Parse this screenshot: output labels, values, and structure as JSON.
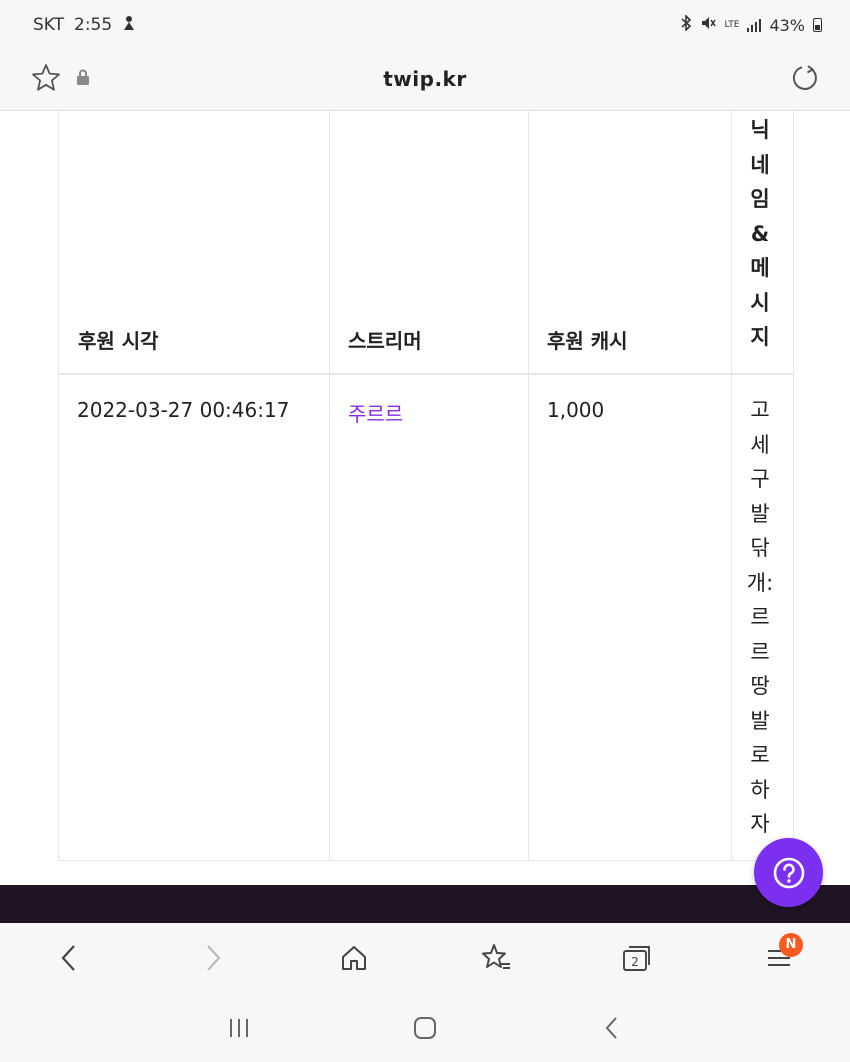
{
  "status_bar": {
    "carrier": "SKT",
    "time": "2:55",
    "network": "LTE",
    "battery": "43%"
  },
  "url_bar": {
    "url": "twip.kr"
  },
  "table": {
    "headers": {
      "time": "후원 시각",
      "streamer": "스트리머",
      "cash": "후원 캐시",
      "message": "닉네임&메시지"
    },
    "rows": [
      {
        "time": "2022-03-27 00:46:17",
        "streamer": "주르르",
        "cash": "1,000",
        "message": "고세구발닦개:르르땅발로하자"
      }
    ]
  },
  "toolbar": {
    "tabs_count": "2",
    "menu_badge": "N"
  },
  "colors": {
    "accent": "#7b2ff0",
    "link": "#8a2be2",
    "footer": "#1f1424",
    "badge": "#ff5a1f"
  }
}
